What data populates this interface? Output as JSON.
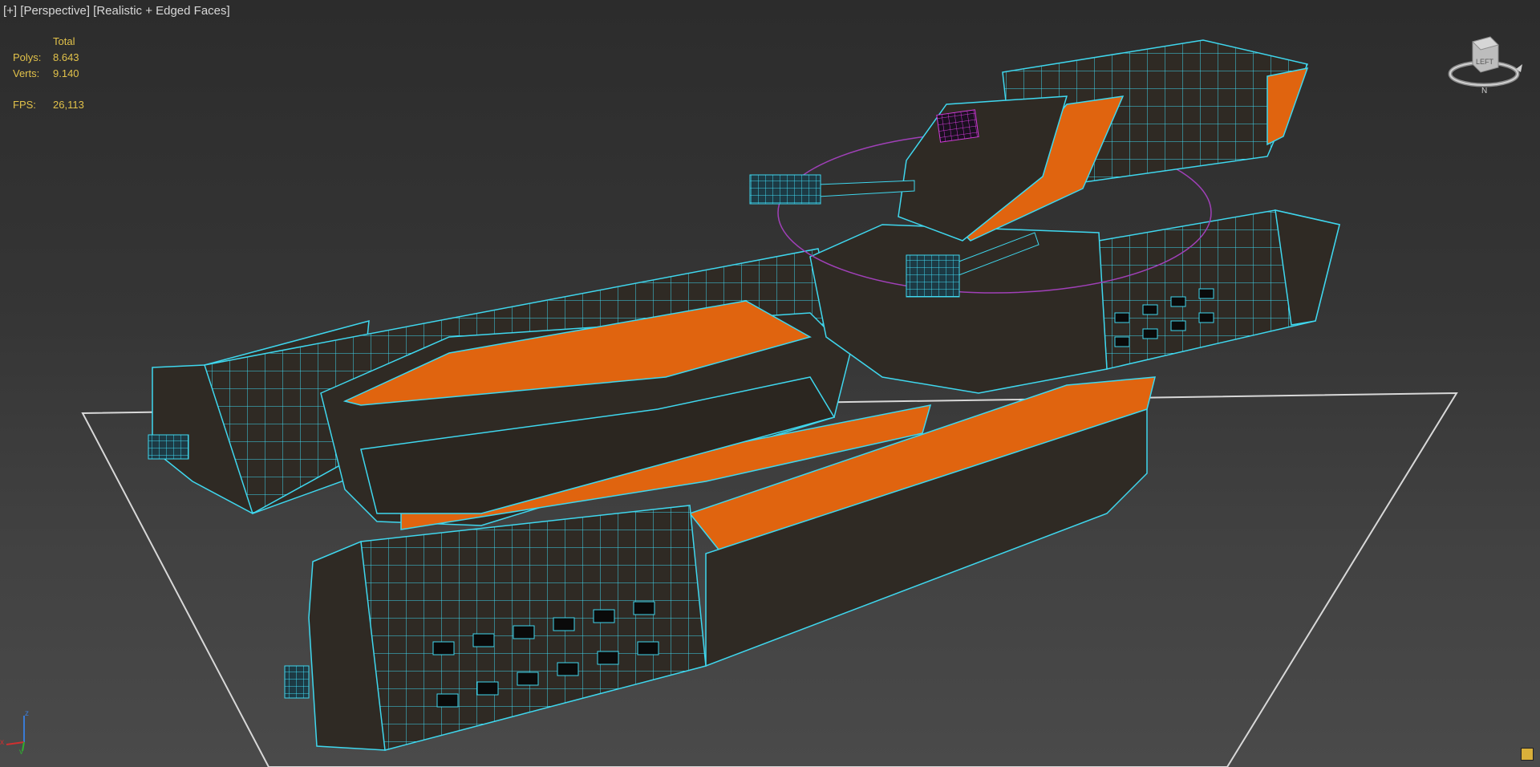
{
  "viewport": {
    "menu": {
      "plus_label": "[+]",
      "view_label": "[Perspective]",
      "shading_label": "[Realistic + Edged Faces]"
    },
    "stats": {
      "header": "Total",
      "polys_label": "Polys:",
      "polys_value": "8.643",
      "verts_label": "Verts:",
      "verts_value": "9.140",
      "fps_label": "FPS:",
      "fps_value": "26,113"
    },
    "viewcube": {
      "face_label": "LEFT",
      "compass_label": "N"
    },
    "axis": {
      "x_label": "x",
      "y_label": "y",
      "z_label": "z"
    }
  },
  "colors": {
    "edges": "#3fd7ee",
    "hull": "#2f2a24",
    "panel_orange": "#e0640f",
    "stats_text": "#e2c24a",
    "ground_grid": "#d8d8d8",
    "gizmo": "#a040b8"
  },
  "icons": [
    "viewcube-icon",
    "axis-tripod-icon",
    "viewport-layout-icon"
  ]
}
